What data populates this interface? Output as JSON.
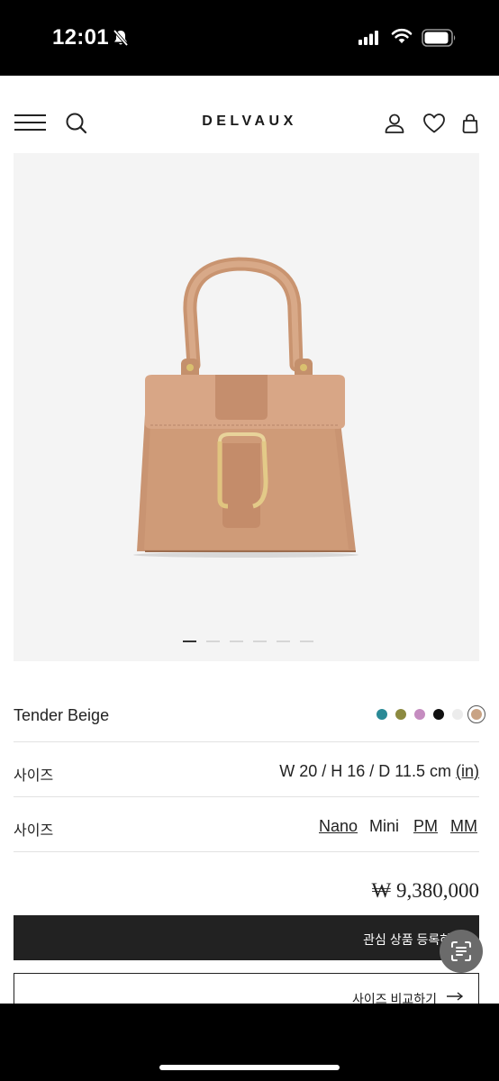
{
  "status": {
    "time": "12:01"
  },
  "nav": {
    "brand": "DELVAUX"
  },
  "product": {
    "color_name": "Tender Beige",
    "swatches": [
      "#2a8a96",
      "#8c8a40",
      "#c58cc0",
      "#111111",
      "#ececec",
      "#c9a384"
    ],
    "selected_swatch": 5,
    "carousel": {
      "count": 6,
      "active_index": 0
    },
    "dimensions_label": "사이즈",
    "dimensions_value": "W 20 / H 16 / D 11.5 cm",
    "dimensions_unit_link": "(in)",
    "size_label": "사이즈",
    "sizes": [
      "Nano",
      "Mini",
      "PM",
      "MM"
    ],
    "price": "₩ 9,380,000"
  },
  "actions": {
    "wishlist_label": "관심 상품 등록하기",
    "compare_label": "사이즈 비교하기"
  },
  "colors": {
    "accent_dark": "#222222",
    "image_bg": "#f4f4f4",
    "bag_tan": "#c89878"
  }
}
